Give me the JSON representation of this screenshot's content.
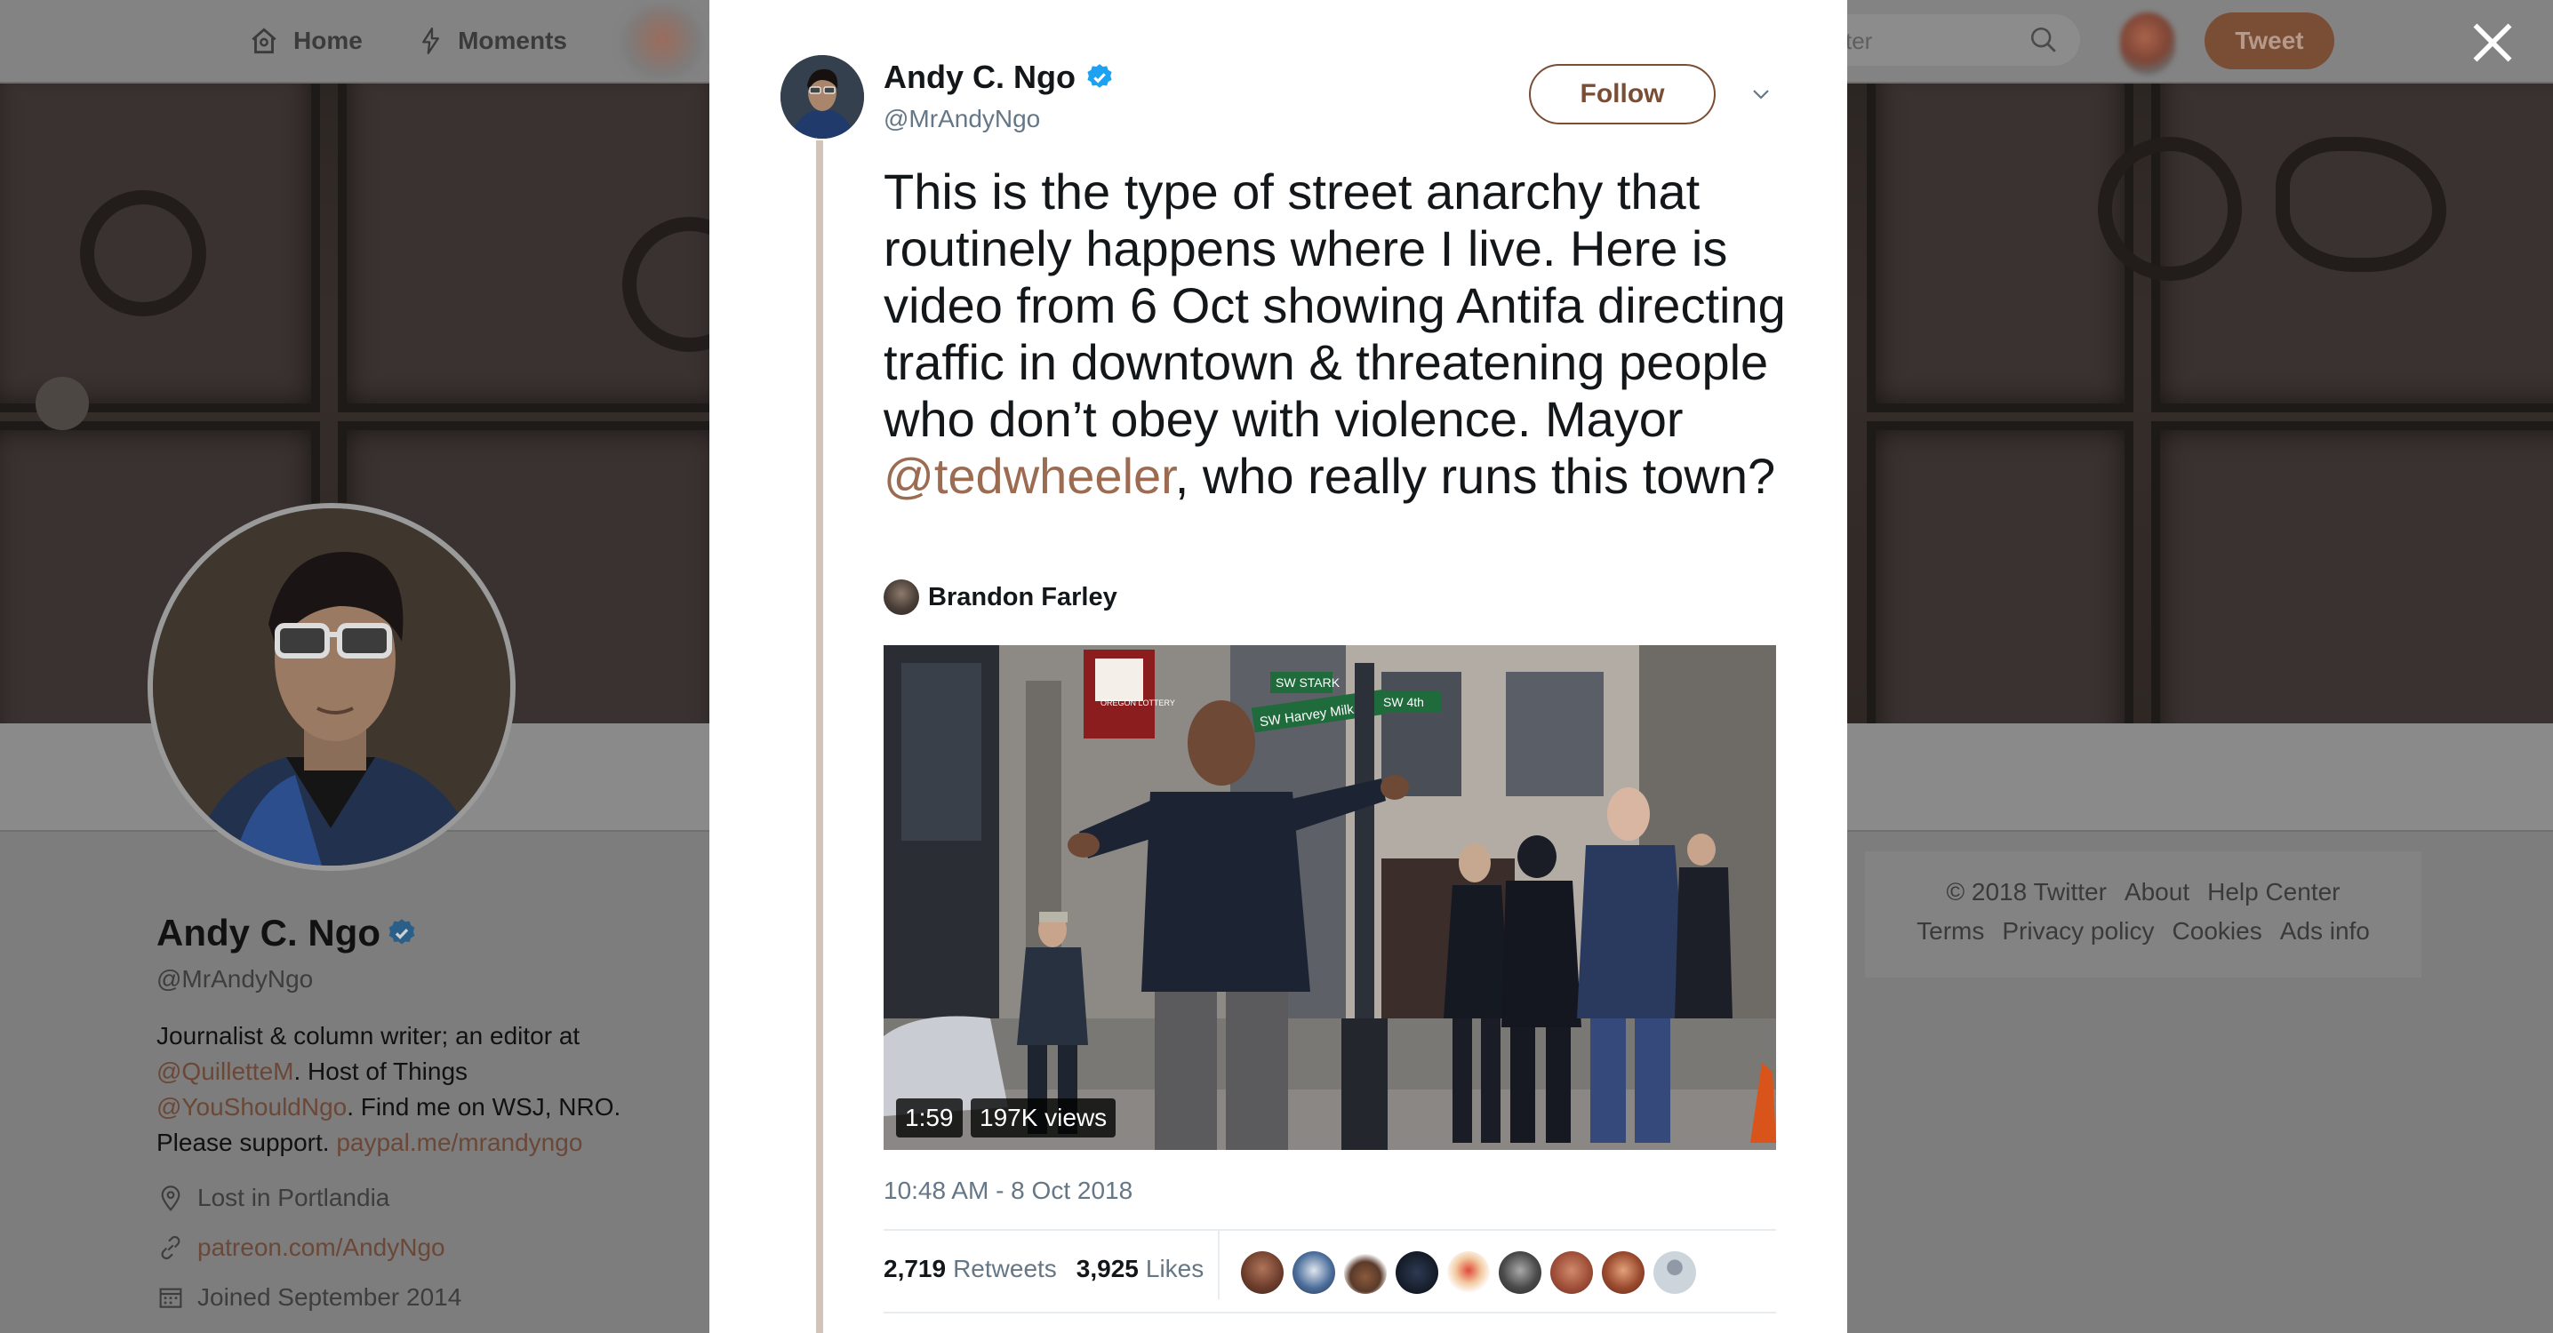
{
  "topbar": {
    "home_label": "Home",
    "moments_label": "Moments",
    "search_placeholder": "Search Twitter",
    "search_visible": "ter",
    "tweet_label": "Tweet"
  },
  "profile": {
    "name": "Andy C. Ngo",
    "handle": "@MrAndyNgo",
    "bio_line1": "Journalist & column writer; an editor at",
    "bio_link1": "@QuilletteM",
    "bio_line2": ". Host of Things",
    "bio_link2": "@YouShouldNgo",
    "bio_line3": ". Find me on WSJ, NRO.",
    "bio_line4": "Please support. ",
    "bio_link3": "paypal.me/mrandyngo",
    "location": "Lost in Portlandia",
    "website": "patreon.com/AndyNgo",
    "joined": "Joined September 2014"
  },
  "footer": {
    "row1": [
      "© 2018 Twitter",
      "About",
      "Help Center"
    ],
    "row2": [
      "Terms",
      "Privacy policy",
      "Cookies",
      "Ads info"
    ]
  },
  "tweet": {
    "author_name": "Andy C. Ngo",
    "author_handle": "@MrAndyNgo",
    "follow_label": "Follow",
    "text_before": "This is the type of street anarchy that routinely happens where I live. Here is video from 6 Oct showing Antifa directing traffic in downtown & threatening people who don’t obey with violence. Mayor ",
    "mention": "@tedwheeler",
    "text_after": ", who really runs this town?",
    "video_credit": "Brandon Farley",
    "video_duration": "1:59",
    "video_views": "197K views",
    "video_signs": {
      "street1": "SW STARK",
      "street2": "SW Harvey Milk",
      "street3": "SW 4th",
      "lottery": "OREGON LOTTERY"
    },
    "timestamp": "10:48 AM - 8 Oct 2018",
    "retweets_count": "2,719",
    "retweets_label": "Retweets",
    "likes_count": "3,925",
    "likes_label": "Likes"
  },
  "colors": {
    "accent": "#9b6b52",
    "follow_border": "#7a4d35",
    "verified": "#1da1f2",
    "secondary_text": "#657786"
  },
  "icons": {
    "home": "home-icon",
    "moments": "lightning-icon",
    "search": "search-icon",
    "close": "close-icon",
    "verified": "verified-badge-icon",
    "caret": "chevron-down-icon",
    "location": "location-pin-icon",
    "link": "link-icon",
    "calendar": "calendar-icon"
  }
}
